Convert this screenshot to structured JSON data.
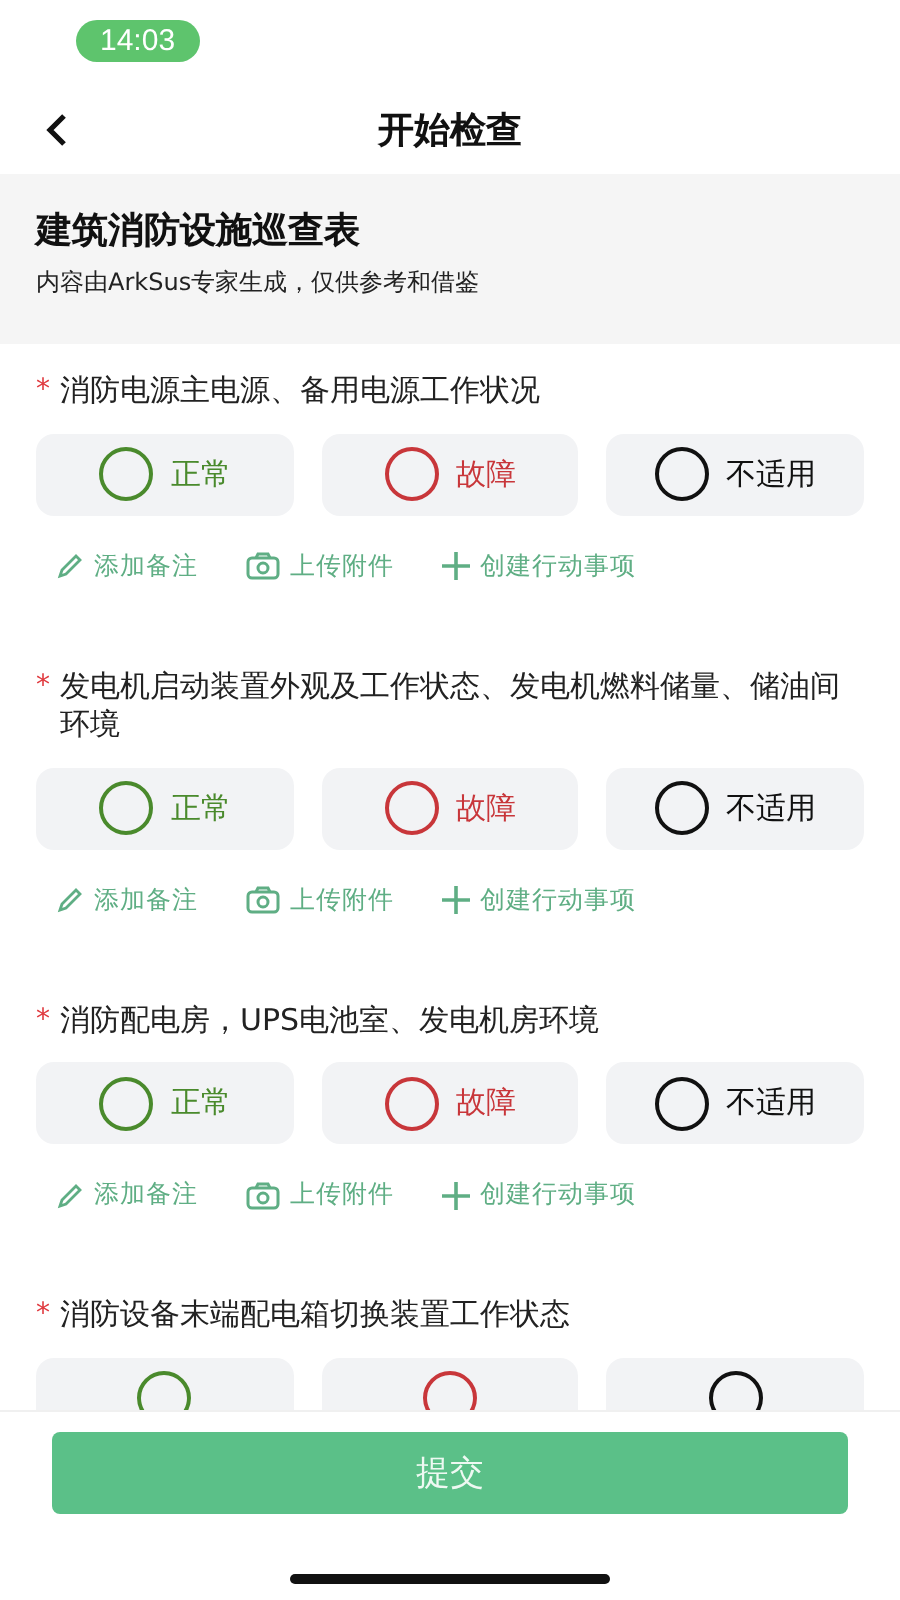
{
  "status_bar": {
    "time": "14:03"
  },
  "nav": {
    "title": "开始检查"
  },
  "header": {
    "title": "建筑消防设施巡查表",
    "subtitle": "内容由ArkSus专家生成，仅供参考和借鉴"
  },
  "items": [
    {
      "required": "*",
      "question": "消防电源主电源、备用电源工作状况",
      "options": [
        {
          "kind": "normal",
          "label": "正常",
          "selected": false
        },
        {
          "kind": "fault",
          "label": "故障",
          "selected": false
        },
        {
          "kind": "na",
          "label": "不适用",
          "selected": false
        }
      ],
      "actions": [
        {
          "kind": "note",
          "label": "添加备注"
        },
        {
          "kind": "upload",
          "label": "上传附件"
        },
        {
          "kind": "create",
          "label": "创建行动事项"
        }
      ]
    },
    {
      "required": "*",
      "question": "发电机启动装置外观及工作状态、发电机燃料储量、储油间环境",
      "options": [
        {
          "kind": "normal",
          "label": "正常",
          "selected": false
        },
        {
          "kind": "fault",
          "label": "故障",
          "selected": false
        },
        {
          "kind": "na",
          "label": "不适用",
          "selected": false
        }
      ],
      "actions": [
        {
          "kind": "note",
          "label": "添加备注"
        },
        {
          "kind": "upload",
          "label": "上传附件"
        },
        {
          "kind": "create",
          "label": "创建行动事项"
        }
      ]
    },
    {
      "required": "*",
      "question": "消防配电房，UPS电池室、发电机房环境",
      "options": [
        {
          "kind": "normal",
          "label": "正常",
          "selected": false
        },
        {
          "kind": "fault",
          "label": "故障",
          "selected": false
        },
        {
          "kind": "na",
          "label": "不适用",
          "selected": false
        }
      ],
      "actions": [
        {
          "kind": "note",
          "label": "添加备注"
        },
        {
          "kind": "upload",
          "label": "上传附件"
        },
        {
          "kind": "create",
          "label": "创建行动事项"
        }
      ]
    },
    {
      "required": "*",
      "question": "消防设备末端配电箱切换装置工作状态",
      "options": [
        {
          "kind": "normal",
          "selected": false
        },
        {
          "kind": "fault",
          "selected": false
        },
        {
          "kind": "na",
          "selected": false
        }
      ]
    }
  ],
  "submit": {
    "label": "提交"
  }
}
